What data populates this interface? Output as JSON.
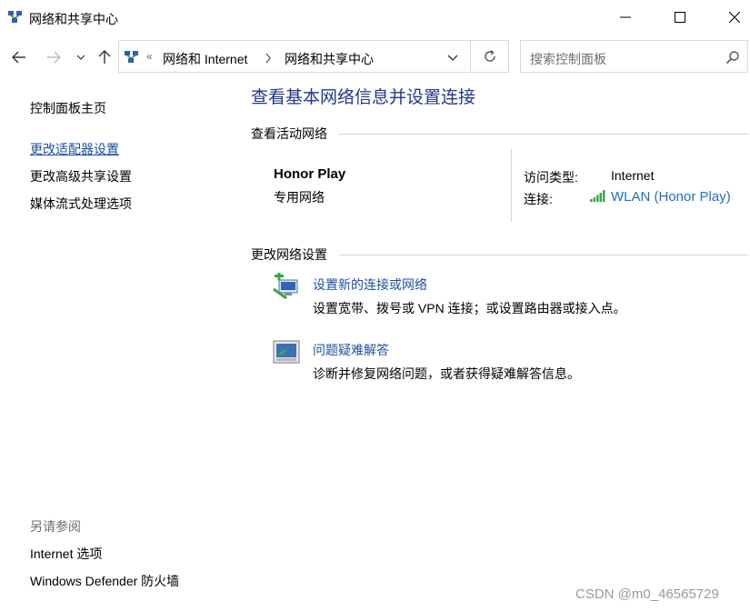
{
  "window": {
    "title": "网络和共享中心"
  },
  "navigation": {
    "breadcrumb": [
      "网络和 Internet",
      "网络和共享中心"
    ],
    "breadcrumb_prefix": "«",
    "search_placeholder": "搜索控制面板"
  },
  "sidebar": {
    "home": "控制面板主页",
    "links": [
      "更改适配器设置",
      "更改高级共享设置",
      "媒体流式处理选项"
    ],
    "see_also_heading": "另请参阅",
    "see_also": [
      "Internet 选项",
      "Windows Defender 防火墙"
    ]
  },
  "main": {
    "title": "查看基本网络信息并设置连接",
    "active_networks_heading": "查看活动网络",
    "network": {
      "name": "Honor Play",
      "type": "专用网络",
      "access_type_label": "访问类型:",
      "access_type_value": "Internet",
      "connection_label": "连接:",
      "connection_value": "WLAN (Honor Play)"
    },
    "change_settings_heading": "更改网络设置",
    "tasks": [
      {
        "title": "设置新的连接或网络",
        "description": "设置宽带、拨号或 VPN 连接；或设置路由器或接入点。",
        "icon": "new-connection-icon"
      },
      {
        "title": "问题疑难解答",
        "description": "诊断并修复网络问题，或者获得疑难解答信息。",
        "icon": "troubleshoot-icon"
      }
    ]
  },
  "watermark": "CSDN @m0_46565729",
  "colors": {
    "title": "#1e3a8a",
    "link": "#1e50a2",
    "connection_link": "#1e6fc2",
    "muted": "#6d6d6d"
  }
}
